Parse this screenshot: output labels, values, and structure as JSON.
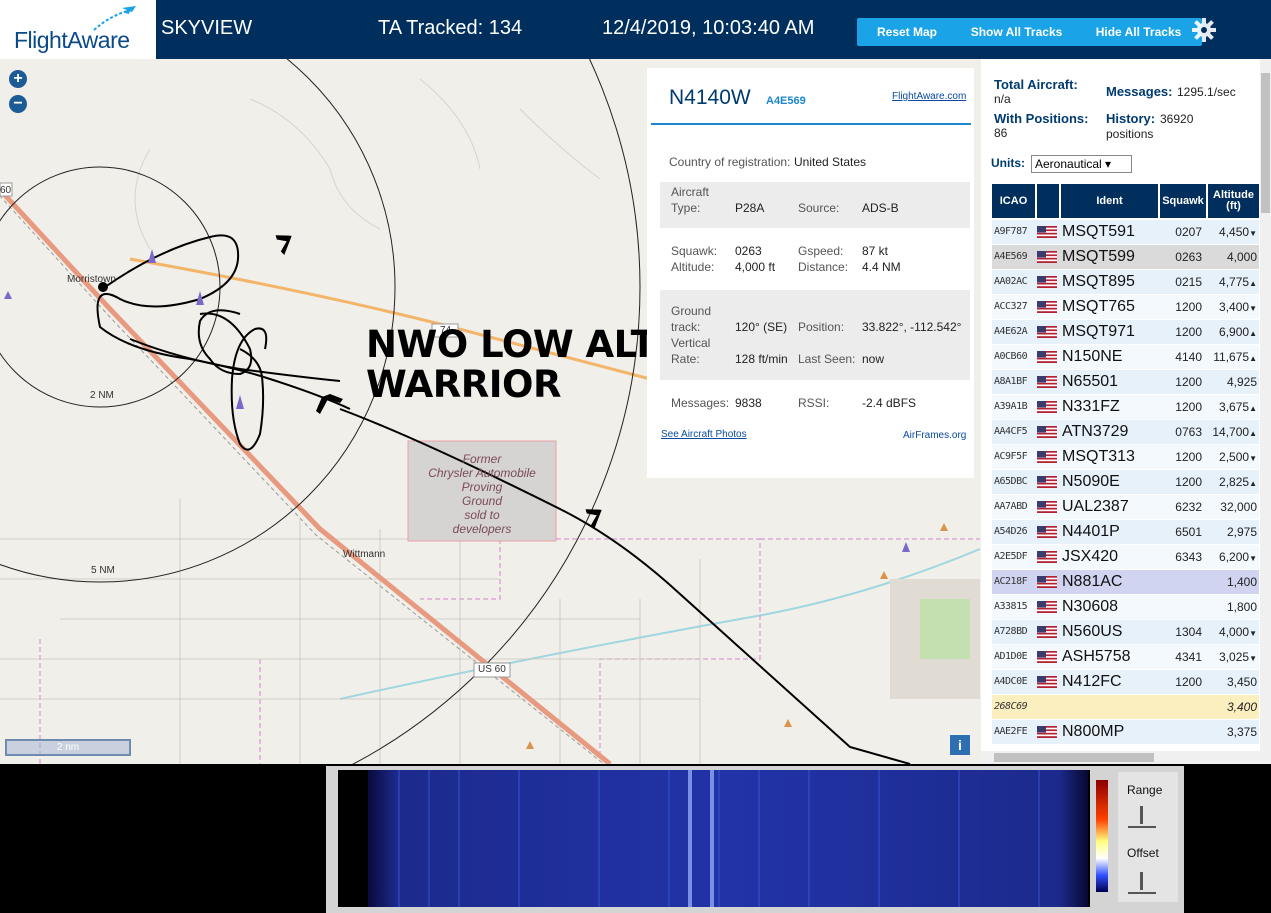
{
  "header": {
    "logo_text": "FlightAware",
    "app_name": "SKYVIEW",
    "tracked": "TA Tracked: 134",
    "datetime": "12/4/2019, 10:03:40 AM",
    "buttons": {
      "reset_map": "Reset Map",
      "show_all": "Show All Tracks",
      "hide_all": "Hide All Tracks"
    },
    "brand_color": "#002f5d",
    "button_color": "#1aa3e6"
  },
  "map": {
    "zoom_in": "+",
    "zoom_out": "−",
    "annotation": [
      "NWO LOW ALT",
      "WARRIOR"
    ],
    "labels": {
      "morristown": "Morristown",
      "wittmann": "Wittmann",
      "ring_2nm": "2 NM",
      "ring_5nm": "5 NM",
      "road_60": "60",
      "road_74": "74",
      "us60": "US 60",
      "former_site": [
        "Former",
        "Chrysler Automobile",
        "Proving",
        "Ground",
        "sold to",
        "developers"
      ]
    },
    "scale": "2 nm",
    "info_button": "i"
  },
  "aircraft_info": {
    "registration": "N4140W",
    "hex": "A4E569",
    "flightaware_link": "FlightAware.com",
    "country_label": "Country of registration:",
    "country": "United States",
    "aircraft_type_label": [
      "Aircraft",
      "Type:"
    ],
    "aircraft_type": "P28A",
    "source_label": "Source:",
    "source": "ADS-B",
    "squawk_label": "Squawk:",
    "squawk": "0263",
    "gspeed_label": "Gspeed:",
    "gspeed": "87 kt",
    "altitude_label": "Altitude:",
    "altitude": "4,000 ft",
    "distance_label": "Distance:",
    "distance": "4.4 NM",
    "ground_track_label": [
      "Ground",
      "track:"
    ],
    "ground_track": "120° (SE)",
    "position_label": "Position:",
    "position": "33.822°, -112.542°",
    "vertical_rate_label": [
      "Vertical",
      "Rate:"
    ],
    "vertical_rate": "128 ft/min",
    "last_seen_label": "Last Seen:",
    "last_seen": "now",
    "messages_label": "Messages:",
    "messages": "9838",
    "rssi_label": "RSSI:",
    "rssi": "-2.4 dBFS",
    "photos_link": "See Aircraft Photos",
    "airframes_link": "AirFrames.org"
  },
  "sidebar": {
    "total_aircraft_label": "Total Aircraft:",
    "total_aircraft": "n/a",
    "messages_label": "Messages:",
    "messages": "1295.1/sec",
    "with_positions_label": "With Positions:",
    "with_positions": "86",
    "history_label": "History:",
    "history": [
      "36920",
      "positions"
    ],
    "units_label": "Units:",
    "units_value": "Aeronautical ▾",
    "columns": {
      "icao": "ICAO",
      "ident": "Ident",
      "squawk": "Squawk",
      "altitude": [
        "Altitude",
        "(ft)"
      ]
    },
    "rows": [
      {
        "icao": "A9F787",
        "ident": "MSQT591",
        "squawk": "0207",
        "alt": "4,450",
        "trend": "▼",
        "flag": true,
        "style": ""
      },
      {
        "icao": "A4E569",
        "ident": "MSQT599",
        "squawk": "0263",
        "alt": "4,000",
        "trend": "",
        "flag": true,
        "style": "selected"
      },
      {
        "icao": "AA02AC",
        "ident": "MSQT895",
        "squawk": "0215",
        "alt": "4,775",
        "trend": "▲",
        "flag": true,
        "style": ""
      },
      {
        "icao": "ACC327",
        "ident": "MSQT765",
        "squawk": "1200",
        "alt": "3,400",
        "trend": "▼",
        "flag": true,
        "style": ""
      },
      {
        "icao": "A4E62A",
        "ident": "MSQT971",
        "squawk": "1200",
        "alt": "6,900",
        "trend": "▲",
        "flag": true,
        "style": ""
      },
      {
        "icao": "A0CB60",
        "ident": "N150NE",
        "squawk": "4140",
        "alt": "11,675",
        "trend": "▲",
        "flag": true,
        "style": ""
      },
      {
        "icao": "A8A1BF",
        "ident": "N65501",
        "squawk": "1200",
        "alt": "4,925",
        "trend": "",
        "flag": true,
        "style": ""
      },
      {
        "icao": "A39A1B",
        "ident": "N331FZ",
        "squawk": "1200",
        "alt": "3,675",
        "trend": "▲",
        "flag": true,
        "style": ""
      },
      {
        "icao": "AA4CF5",
        "ident": "ATN3729",
        "squawk": "0763",
        "alt": "14,700",
        "trend": "▲",
        "flag": true,
        "style": ""
      },
      {
        "icao": "AC9F5F",
        "ident": "MSQT313",
        "squawk": "1200",
        "alt": "2,500",
        "trend": "▼",
        "flag": true,
        "style": ""
      },
      {
        "icao": "A65DBC",
        "ident": "N5090E",
        "squawk": "1200",
        "alt": "2,825",
        "trend": "▲",
        "flag": true,
        "style": ""
      },
      {
        "icao": "AA7ABD",
        "ident": "UAL2387",
        "squawk": "6232",
        "alt": "32,000",
        "trend": "",
        "flag": true,
        "style": ""
      },
      {
        "icao": "A54D26",
        "ident": "N4401P",
        "squawk": "6501",
        "alt": "2,975",
        "trend": "",
        "flag": true,
        "style": ""
      },
      {
        "icao": "A2E5DF",
        "ident": "JSX420",
        "squawk": "6343",
        "alt": "6,200",
        "trend": "▼",
        "flag": true,
        "style": ""
      },
      {
        "icao": "AC218F",
        "ident": "N881AC",
        "squawk": "",
        "alt": "1,400",
        "trend": "",
        "flag": true,
        "style": "mlat"
      },
      {
        "icao": "A33815",
        "ident": "N30608",
        "squawk": "",
        "alt": "1,800",
        "trend": "",
        "flag": true,
        "style": ""
      },
      {
        "icao": "A728BD",
        "ident": "N560US",
        "squawk": "1304",
        "alt": "4,000",
        "trend": "▼",
        "flag": true,
        "style": ""
      },
      {
        "icao": "AD1D0E",
        "ident": "ASH5758",
        "squawk": "4341",
        "alt": "3,025",
        "trend": "▼",
        "flag": true,
        "style": ""
      },
      {
        "icao": "A4DC0E",
        "ident": "N412FC",
        "squawk": "1200",
        "alt": "3,450",
        "trend": "",
        "flag": true,
        "style": ""
      },
      {
        "icao": "268C69",
        "ident": "",
        "squawk": "",
        "alt": "3,400",
        "trend": "",
        "flag": false,
        "style": "tisb"
      },
      {
        "icao": "AAE2FE",
        "ident": "N800MP",
        "squawk": "",
        "alt": "3,375",
        "trend": "",
        "flag": true,
        "style": ""
      }
    ]
  },
  "waterfall": {
    "range_label": "Range",
    "offset_label": "Offset"
  }
}
